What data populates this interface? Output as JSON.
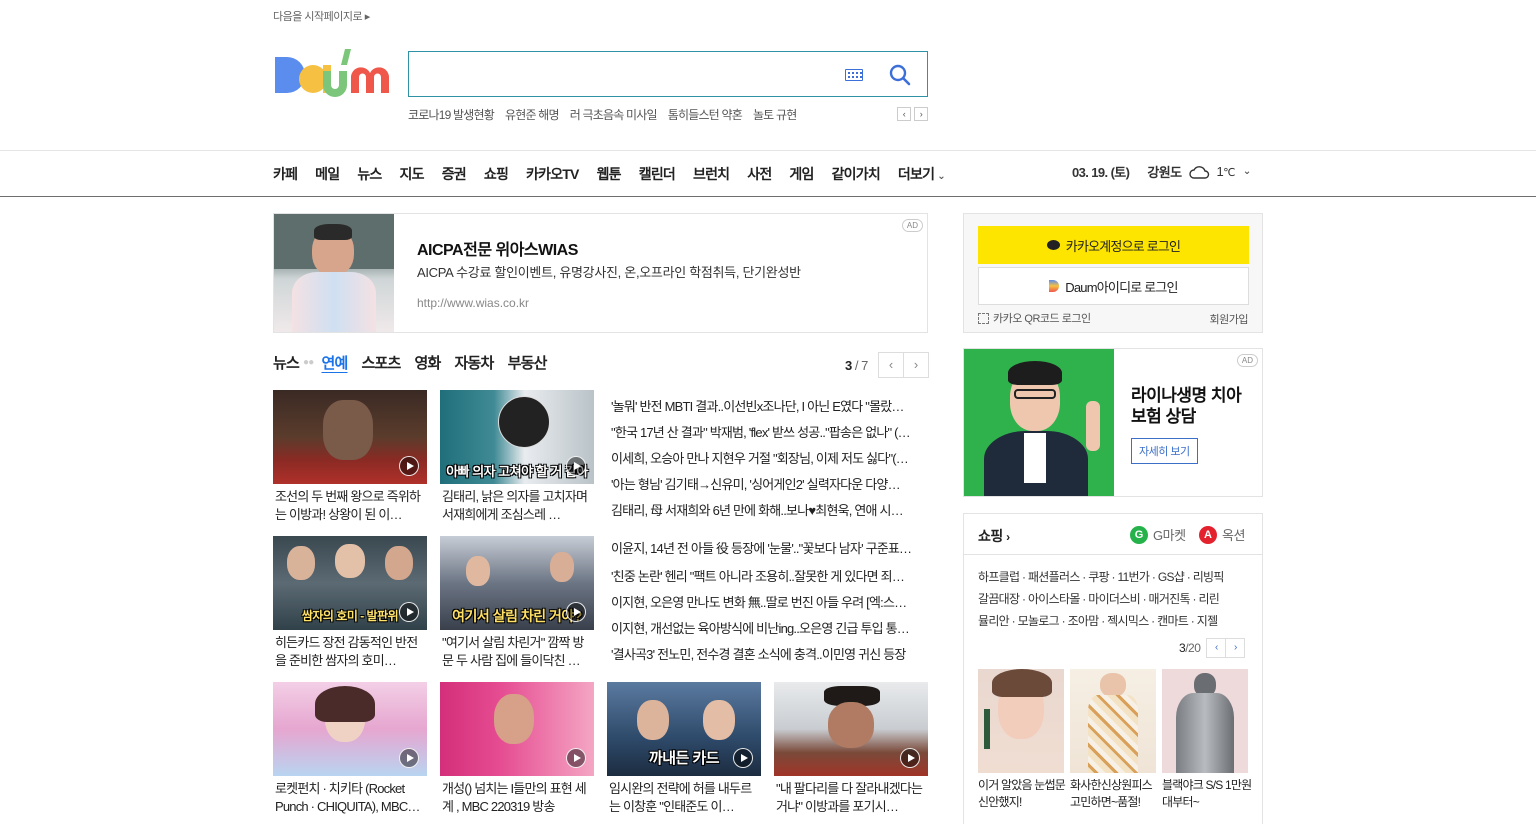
{
  "top_link": "다음을 시작페이지로",
  "search": {
    "placeholder": "",
    "value": ""
  },
  "trends": [
    "코로나19 발생현황",
    "유현준 해명",
    "러 극초음속 미사일",
    "톰히들스턴 약혼",
    "놀토 규현"
  ],
  "nav": [
    "카페",
    "메일",
    "뉴스",
    "지도",
    "증권",
    "쇼핑",
    "카카오TV",
    "웹툰",
    "캘린더",
    "브런치",
    "사전",
    "게임",
    "같이가치",
    "더보기"
  ],
  "date": "03. 19. (토)",
  "weather": {
    "region": "강원도",
    "temp": "1",
    "unit": "℃",
    "icon": "cloud-icon"
  },
  "ad_banner": {
    "tag": "AD",
    "title": "AICPA전문 위아스WIAS",
    "desc": "AICPA 수강료 할인이벤트, 유명강사진, 온,오프라인 학점취득, 단기완성반",
    "url": "http://www.wias.co.kr"
  },
  "news": {
    "tabs": [
      "뉴스",
      "연예",
      "스포츠",
      "영화",
      "자동차",
      "부동산"
    ],
    "active_tab": "연예",
    "page": "3",
    "total": "7",
    "thumbs": [
      {
        "title": "조선의 두 번째 왕으로 즉위하는 이방과! 상왕이 된 이…",
        "caption": ""
      },
      {
        "title": "김태리, 낡은 의자를 고치자며 서재희에게 조심스레 …",
        "caption": "아빠 의자 고쳐야 할 거 같아"
      },
      {
        "title": "히든카드 장전 감동적인 반전을 준비한 쌈자의 호미…",
        "caption": "쌈자의 호미 - 발판위"
      },
      {
        "title": "\"여기서 살림 차린거\" 깜짝 방문 두 사람 집에 들이닥친 …",
        "caption": "여기서 살림 차린 거야?"
      },
      {
        "title": "로켓펀치 · 치키타 (Rocket Punch · CHIQUITA), MBC…",
        "caption": ""
      },
      {
        "title": "개성() 넘치는 I들만의 표현 세계 , MBC 220319 방송",
        "caption": ""
      },
      {
        "title": "임시완의 전략에 허를 내두르는 이창훈 \"인태준도 이…",
        "caption": "까내든 카드"
      },
      {
        "title": "\"내 팔다리를 다 잘라내겠다는 거냐\" 이방과를 포기시…",
        "caption": ""
      }
    ],
    "headlines_a": [
      "'놀뭐' 반전 MBTI 결과..이선빈x조나단, I 아닌 E였다 \"몰랐…",
      "\"한국 17년 산 결과\" 박재범, 'flex' 받쓰 성공..\"팝송은 없나\" (…",
      "이세희, 오승아 만나 지현우 거절 \"회장님, 이제 저도 싫다\"(…",
      "'아는 형님' 김기태→신유미, '싱어게인2' 실력자다운 다양…",
      "김태리, 母 서재희와 6년 만에 화해..보나♥최현욱, 연애 시…"
    ],
    "headlines_b": [
      "이윤지, 14년 전 아들 役 등장에 '눈물'..\"꽃보다 남자' 구준표…",
      "'친중 논란' 헨리 \"팩트 아니라 조용히..잘못한 게 있다면 죄…",
      "이지현, 오은영 만나도 변화 無..딸로 번진 아들 우려 [엑:스…",
      "이지현, 개선없는 육아방식에 비난ing..오은영 긴급 투입 통…",
      "'결사곡3' 전노민, 전수경 결혼 소식에 충격..이민영 귀신 등장"
    ]
  },
  "login": {
    "kakao": "카카오계정으로 로그인",
    "daum": "Daum아이디로 로그인",
    "qr": "카카오 QR코드 로그인",
    "join": "회원가입"
  },
  "side_ad": {
    "tag": "AD",
    "title": "라이나생명 치아보험 상담",
    "button": "자세히 보기"
  },
  "shopping": {
    "title": "쇼핑",
    "gmarket": "G마켓",
    "auction": "옥션",
    "rows": [
      [
        "하프클럽",
        "패션플러스",
        "쿠팡",
        "11번가",
        "GS샵",
        "리빙픽"
      ],
      [
        "갈끔대장",
        "아이스타몰",
        "마이더스비",
        "매거진톡",
        "리린"
      ],
      [
        "뮬리안",
        "모놀로그",
        "조아맘",
        "젝시믹스",
        "캔마트",
        "지젤"
      ]
    ],
    "page": "3",
    "total": "20",
    "products": [
      {
        "title": "이거 알았음 눈썹문신안했지!"
      },
      {
        "title": "화사한신상원피스 고민하면~품절!"
      },
      {
        "title": "블랙야크 S/S 1만원대부터~"
      }
    ]
  },
  "colors": {
    "accent": "#1a73e8",
    "kakao_yellow": "#fee500",
    "search_border": "#2f93a5",
    "ad_green": "#2fb24c"
  }
}
